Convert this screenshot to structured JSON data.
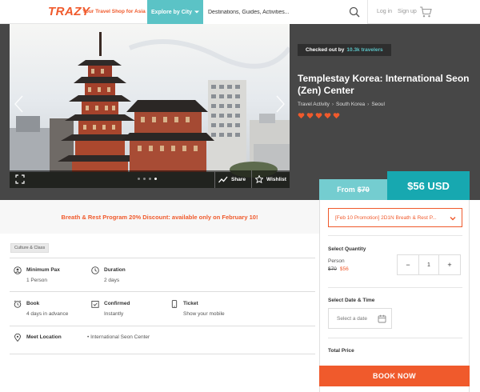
{
  "header": {
    "logo": "TRAZY",
    "tagline": "Your Travel Shop for Asia",
    "explore_label": "Explore by City",
    "search_placeholder": "Destinations, Guides, Activities...",
    "login_label": "Log in",
    "signup_label": "Sign up"
  },
  "hero": {
    "share_label": "Share",
    "wishlist_label": "Wishlist",
    "slide_count": 4,
    "active_slide": 4
  },
  "product": {
    "checked_prefix": "Checked out by",
    "checked_count": "10.3k travelers",
    "title": "Templestay Korea: International Seon (Zen) Center",
    "breadcrumbs": [
      "Travel Activity",
      "South Korea",
      "Seoul"
    ],
    "rating_hearts": 5
  },
  "pricing": {
    "from_label": "From",
    "from_price": "$70",
    "price": "$56 USD"
  },
  "promo": {
    "text": "Breath & Rest Program 20% Discount: available only on February 10!"
  },
  "tag": "Culture & Class",
  "details": {
    "min_pax_label": "Minimum Pax",
    "min_pax_value": "1 Person",
    "duration_label": "Duration",
    "duration_value": "2 days",
    "book_label": "Book",
    "book_value": "4 days in advance",
    "confirmed_label": "Confirmed",
    "confirmed_value": "Instantly",
    "ticket_label": "Ticket",
    "ticket_value": "Show your mobile",
    "meet_label": "Meet Location",
    "meet_value": "• International Seon Center"
  },
  "booking": {
    "selected_option": "[Feb 10 Promotion] 2D1N Breath & Rest P...",
    "quantity_label": "Select Quantity",
    "person_label": "Person",
    "person_old_price": "$70",
    "person_new_price": "$56",
    "quantity": "1",
    "minus": "−",
    "plus": "+",
    "date_label": "Select Date & Time",
    "date_placeholder": "Select a date",
    "total_label": "Total Price",
    "book_now": "BOOK NOW"
  },
  "colors": {
    "brand": "#f05a2c",
    "teal": "#5bc3c6",
    "teal_dark": "#17a8b0",
    "band": "#474747"
  }
}
